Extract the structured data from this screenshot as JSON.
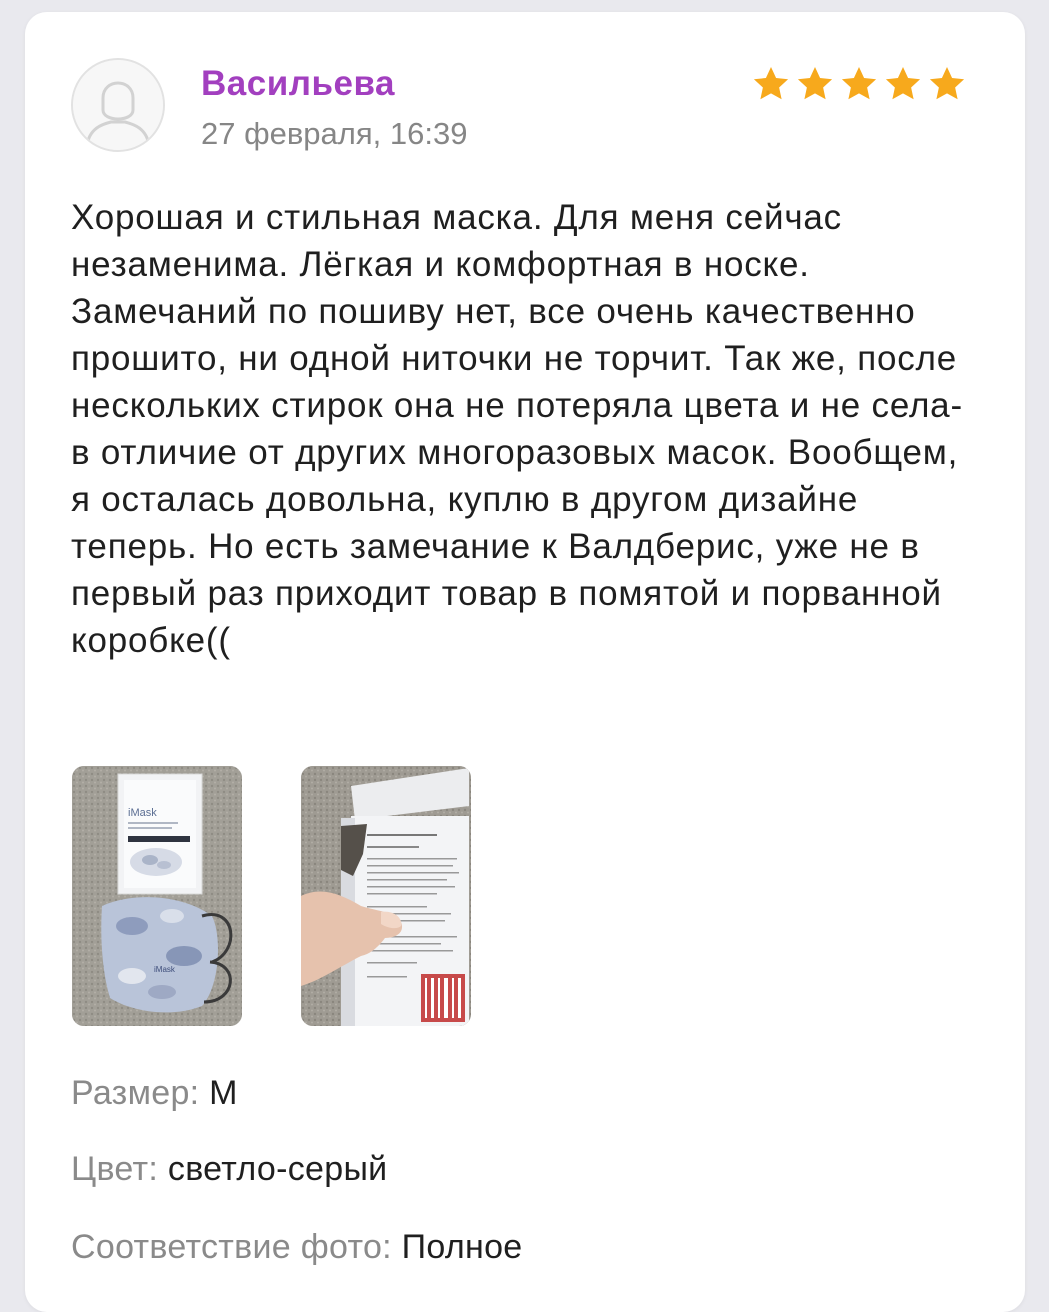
{
  "review": {
    "author": "Васильева",
    "date": "27 февраля, 16:39",
    "rating": 5,
    "max_rating": 5,
    "text": "Хорошая и стильная маска. Для меня сейчас незаменима. Лёгкая и комфортная в носке. Замечаний по пошиву нет, все очень качественно прошито, ни одной ниточки не торчит. Так же, после нескольких стирок она не потеряла цвета и не села- в отличие от других многоразовых масок. Вообщем, я осталась довольна, куплю в другом дизайне теперь. Но есть замечание к Валдберис, уже не в первый раз приходит товар в помятой и порванной коробке((",
    "photos": [
      {
        "icon": "photo-box-and-mask",
        "box_brand": "iMask",
        "mask_brand": "iMask"
      },
      {
        "icon": "photo-box-instructions",
        "box_brand": "iMask"
      }
    ],
    "attributes": {
      "size": {
        "label": "Размер:",
        "value": "M"
      },
      "color": {
        "label": "Цвет:",
        "value": "светло-серый"
      },
      "photo_match": {
        "label": "Соответствие фото:",
        "value": "Полное"
      }
    }
  },
  "colors": {
    "author": "#a23fbf",
    "star": "#f7a91c",
    "text": "#1f1f1f",
    "muted": "#8a8a8a",
    "card": "#ffffff",
    "background": "#e9e9ee"
  },
  "icons": {
    "avatar": "user-avatar-placeholder-icon",
    "star": "star-icon"
  }
}
